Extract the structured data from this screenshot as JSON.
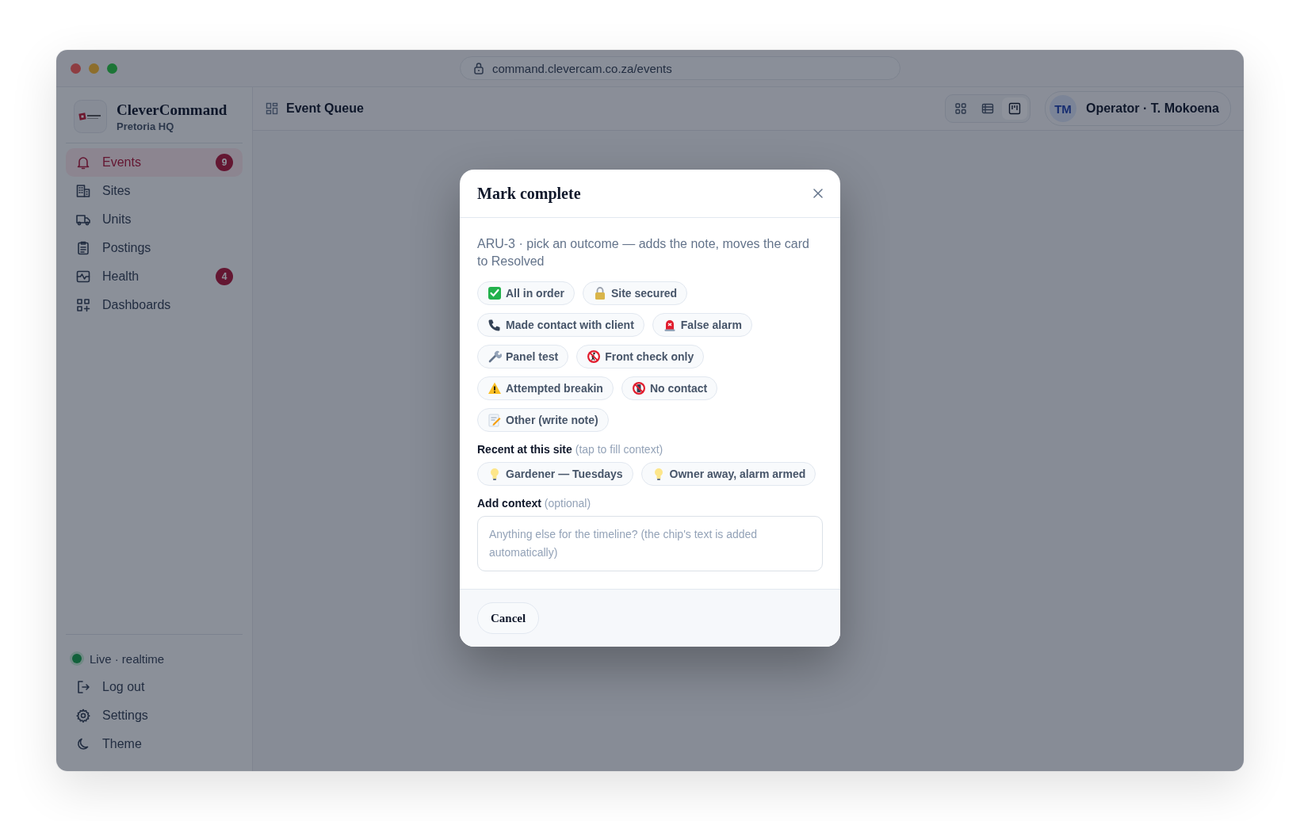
{
  "browser": {
    "url": "command.clevercam.co.za/events"
  },
  "brand": {
    "name": "CleverCommand",
    "location": "Pretoria HQ"
  },
  "nav": [
    {
      "kind": "bell",
      "label": "Events",
      "badge": "9",
      "selected": true
    },
    {
      "kind": "building",
      "label": "Sites",
      "selected": false
    },
    {
      "kind": "truck",
      "label": "Units",
      "selected": false
    },
    {
      "kind": "clipboard",
      "label": "Postings",
      "selected": false
    },
    {
      "kind": "pulse",
      "label": "Health",
      "badge": "4",
      "selected": false
    },
    {
      "kind": "grid",
      "label": "Dashboards",
      "selected": false
    }
  ],
  "sidebar_footer": [
    {
      "kind": "status",
      "label": "Live · realtime"
    },
    {
      "kind": "logout",
      "label": "Log out"
    },
    {
      "kind": "gear",
      "label": "Settings"
    },
    {
      "kind": "moon",
      "label": "Theme"
    }
  ],
  "topbar": {
    "title": "Event Queue",
    "views": [
      {
        "kind": "tiles",
        "selected": false
      },
      {
        "kind": "list",
        "selected": false
      },
      {
        "kind": "board",
        "selected": true
      }
    ],
    "user": {
      "initials": "TM",
      "label": "Operator · T. Mokoena"
    }
  },
  "dialog": {
    "title": "Mark complete",
    "subtitle": "ARU-3 · pick an outcome — adds the note, moves the card to Resolved",
    "outcomes": [
      {
        "kind": "check",
        "label": "All in order"
      },
      {
        "kind": "lock",
        "label": "Site secured"
      },
      {
        "kind": "phone",
        "label": "Made contact with client"
      },
      {
        "kind": "siren",
        "label": "False alarm"
      },
      {
        "kind": "wrench",
        "label": "Panel test"
      },
      {
        "kind": "no-walk",
        "label": "Front check only"
      },
      {
        "kind": "warning",
        "label": "Attempted breakin"
      },
      {
        "kind": "no-phone",
        "label": "No contact"
      },
      {
        "kind": "memo",
        "label": "Other (write note)"
      }
    ],
    "recent_label": "Recent at this site",
    "recent_hint": "(tap to fill context)",
    "recent": [
      {
        "kind": "bulb",
        "label": "Gardener — Tuesdays"
      },
      {
        "kind": "bulb",
        "label": "Owner away, alarm armed"
      }
    ],
    "context_label": "Add context",
    "context_hint": "(optional)",
    "context_placeholder": "Anything else for the timeline? (the chip's text is added automatically)",
    "cancel": "Cancel"
  }
}
